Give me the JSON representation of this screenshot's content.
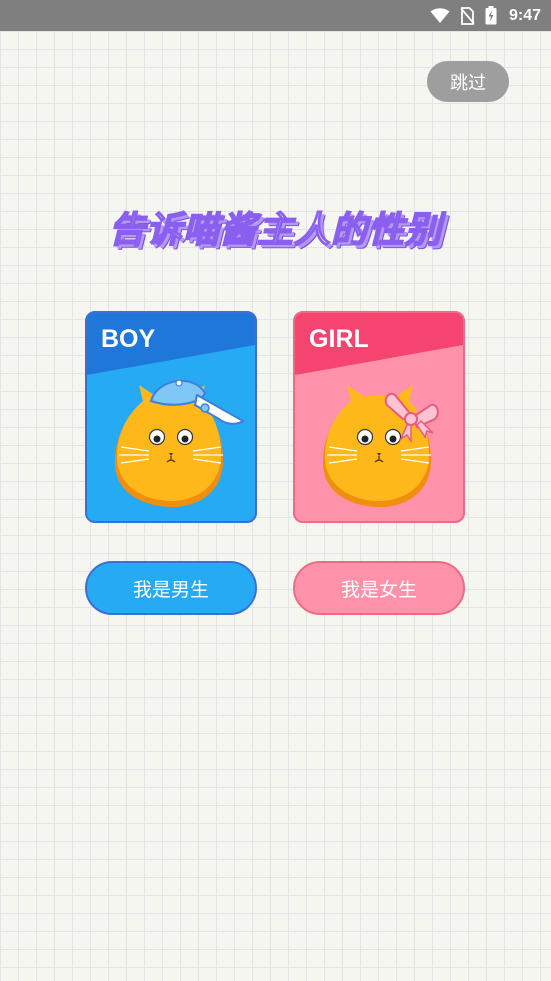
{
  "status_bar": {
    "time": "9:47",
    "icons": [
      "wifi-icon",
      "no-sim-icon",
      "battery-charging-icon"
    ]
  },
  "skip_label": "跳过",
  "title": "告诉喵酱主人的性别",
  "cards": {
    "boy": {
      "label": "BOY",
      "color": "#27aaf4",
      "band_color": "#1f77d9",
      "border_color": "#3a6fd8"
    },
    "girl": {
      "label": "GIRL",
      "color": "#fe92aa",
      "band_color": "#f4446f",
      "border_color": "#ee6a86"
    }
  },
  "buttons": {
    "boy": "我是男生",
    "girl": "我是女生"
  },
  "colors": {
    "status_bar": "#7f7f7f",
    "skip_button": "#9e9e9e",
    "title_outline": "#8a5ff0",
    "cat_body": "#ffb81a",
    "cat_shadow": "#f08e10"
  }
}
